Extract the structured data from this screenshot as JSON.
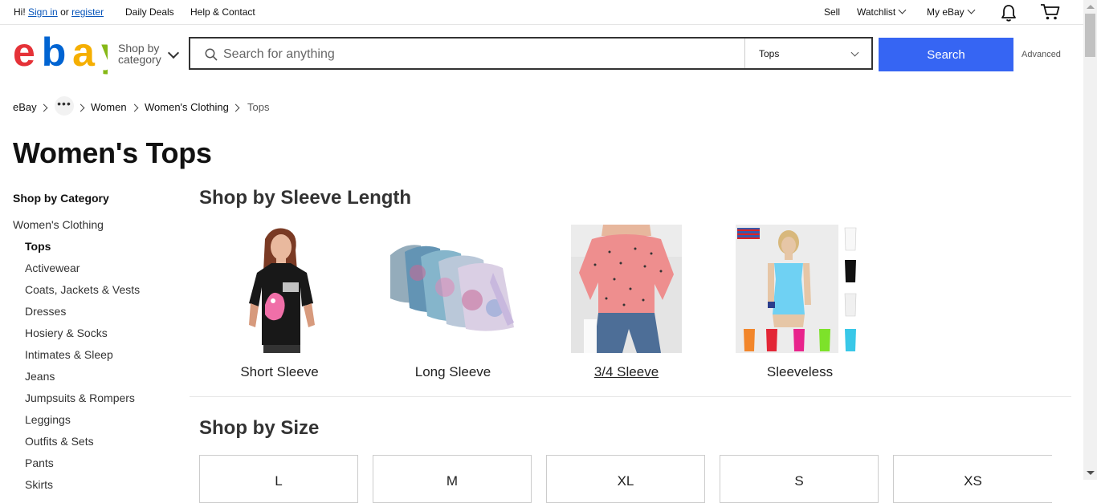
{
  "topbar": {
    "greeting": "Hi!",
    "sign_in": "Sign in",
    "or": "or",
    "register": "register",
    "daily_deals": "Daily Deals",
    "help_contact": "Help & Contact",
    "sell": "Sell",
    "watchlist": "Watchlist",
    "my_ebay": "My eBay"
  },
  "header": {
    "logo": {
      "letters": [
        "e",
        "b",
        "a",
        "y"
      ],
      "colors": [
        "#e53238",
        "#0064d2",
        "#f5af02",
        "#86b817"
      ]
    },
    "shop_by_line1": "Shop by",
    "shop_by_line2": "category",
    "search_placeholder": "Search for anything",
    "category_selected": "Tops",
    "search_button": "Search",
    "advanced": "Advanced",
    "accent_color": "#3665f3"
  },
  "breadcrumb": [
    "eBay",
    "Women",
    "Women's Clothing",
    "Tops"
  ],
  "page_title": "Women's Tops",
  "sidebar": {
    "heading": "Shop by Category",
    "parent": "Women's Clothing",
    "items": [
      "Tops",
      "Activewear",
      "Coats, Jackets & Vests",
      "Dresses",
      "Hosiery & Socks",
      "Intimates & Sleep",
      "Jeans",
      "Jumpsuits & Rompers",
      "Leggings",
      "Outfits & Sets",
      "Pants",
      "Skirts"
    ]
  },
  "sleeve_section": {
    "title": "Shop by Sleeve Length",
    "tiles": [
      {
        "label": "Short Sleeve"
      },
      {
        "label": "Long Sleeve"
      },
      {
        "label": "3/4 Sleeve"
      },
      {
        "label": "Sleeveless"
      }
    ]
  },
  "size_section": {
    "title": "Shop by Size",
    "sizes": [
      "L",
      "M",
      "XL",
      "S",
      "XS"
    ]
  }
}
